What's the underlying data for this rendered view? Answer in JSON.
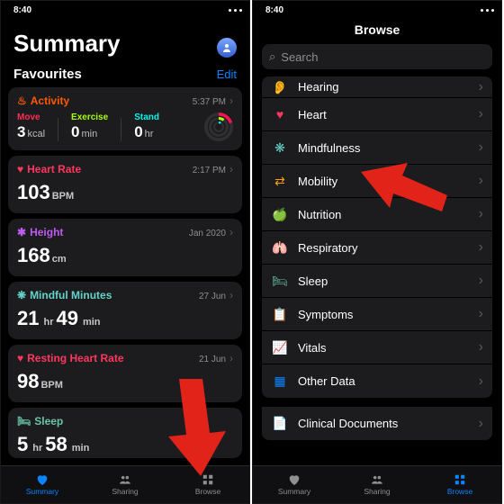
{
  "status_time": "8:40",
  "left": {
    "title": "Summary",
    "favourites_label": "Favourites",
    "edit_label": "Edit",
    "cards": {
      "activity": {
        "title": "Activity",
        "time": "5:37 PM",
        "move_label": "Move",
        "move_value": "3",
        "move_unit": "kcal",
        "exercise_label": "Exercise",
        "exercise_value": "0",
        "exercise_unit": "min",
        "stand_label": "Stand",
        "stand_value": "0",
        "stand_unit": "hr"
      },
      "heart_rate": {
        "title": "Heart Rate",
        "time": "2:17 PM",
        "value": "103",
        "unit": "BPM"
      },
      "height": {
        "title": "Height",
        "time": "Jan 2020",
        "value": "168",
        "unit": "cm"
      },
      "mindful": {
        "title": "Mindful Minutes",
        "time": "27 Jun",
        "h_value": "21",
        "h_unit": "hr",
        "m_value": "49",
        "m_unit": "min"
      },
      "resting": {
        "title": "Resting Heart Rate",
        "time": "21 Jun",
        "value": "98",
        "unit": "BPM"
      },
      "sleep": {
        "title": "Sleep",
        "time": "",
        "h_value": "5",
        "h_unit": "hr",
        "m_value": "58",
        "m_unit": "min"
      }
    },
    "tabs": {
      "summary": "Summary",
      "sharing": "Sharing",
      "browse": "Browse"
    }
  },
  "right": {
    "header": "Browse",
    "search_placeholder": "Search",
    "items": [
      {
        "label": "Hearing",
        "icon": "ear",
        "color": "c-hearing"
      },
      {
        "label": "Heart",
        "icon": "heart",
        "color": "c-heart"
      },
      {
        "label": "Mindfulness",
        "icon": "mind",
        "color": "c-mind"
      },
      {
        "label": "Mobility",
        "icon": "mobility",
        "color": "c-mob"
      },
      {
        "label": "Nutrition",
        "icon": "apple",
        "color": "c-nutr"
      },
      {
        "label": "Respiratory",
        "icon": "lungs",
        "color": "c-resp"
      },
      {
        "label": "Sleep",
        "icon": "bed",
        "color": "c-sleep"
      },
      {
        "label": "Symptoms",
        "icon": "clipboard",
        "color": "c-sympt"
      },
      {
        "label": "Vitals",
        "icon": "vitals",
        "color": "c-vitals"
      },
      {
        "label": "Other Data",
        "icon": "grid",
        "color": "c-other"
      }
    ],
    "clinical_label": "Clinical Documents",
    "tabs": {
      "summary": "Summary",
      "sharing": "Sharing",
      "browse": "Browse"
    }
  }
}
